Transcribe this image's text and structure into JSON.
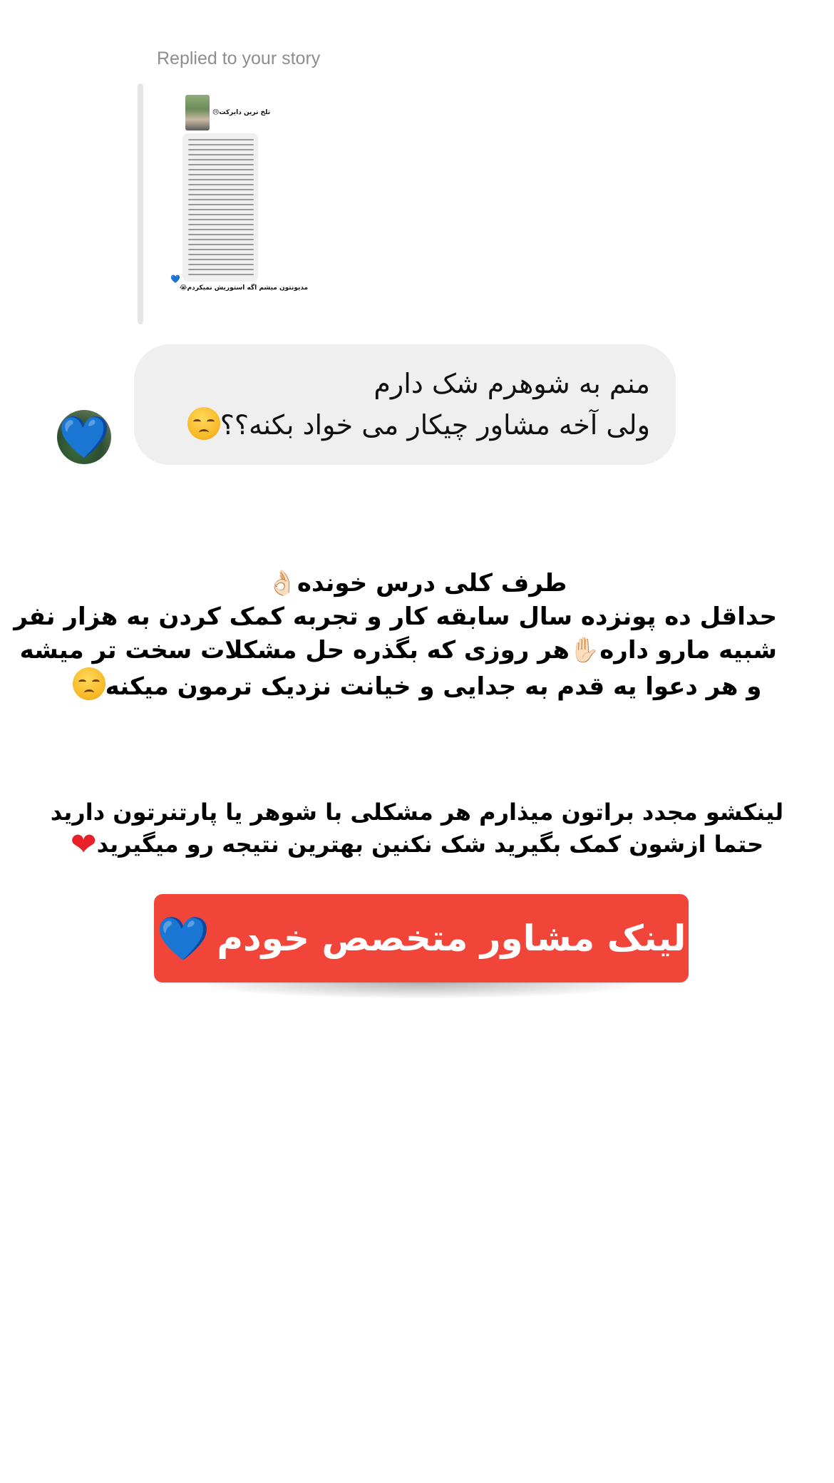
{
  "reply_header": {
    "label": "Replied to your story"
  },
  "story_preview": {
    "title": "تلخ ترین دایرکت😢",
    "caption": "مدیونتون میشم اگه استوریش نمیکردم😭"
  },
  "message": {
    "line1": "منم به شوهرم شک دارم",
    "line2": "ولی آخه مشاور چیکار می خواد بکنه؟؟",
    "emoji_icon": "pensive-face-icon"
  },
  "post_text_1": {
    "line1": "طرف کلی درس خونده👌🏻",
    "line2": "حداقل ده پونزده سال سابقه کار و تجربه کمک کردن به هزار نفر",
    "line3": "شبیه مارو داره✋🏻هر روزی که بگذره حل مشکلات سخت تر میشه",
    "line4": "و هر دعوا یه قدم به جدایی و خیانت نزدیک ترمون میکنه"
  },
  "post_text_2": {
    "line1": "لینکشو مجدد براتون میذارم هر مشکلی با شوهر یا پارتنرتون دارید",
    "line2": "حتما ازشون کمک بگیرید شک نکنین بهترین نتیجه رو میگیرید"
  },
  "cta": {
    "label": "لینک مشاور متخصص  خودم",
    "heart": "💙"
  },
  "colors": {
    "cta_background": "#f2453a",
    "cta_underline": "#2fd3b0",
    "bubble_background": "#efefef",
    "label_gray": "#8e8e8e"
  }
}
